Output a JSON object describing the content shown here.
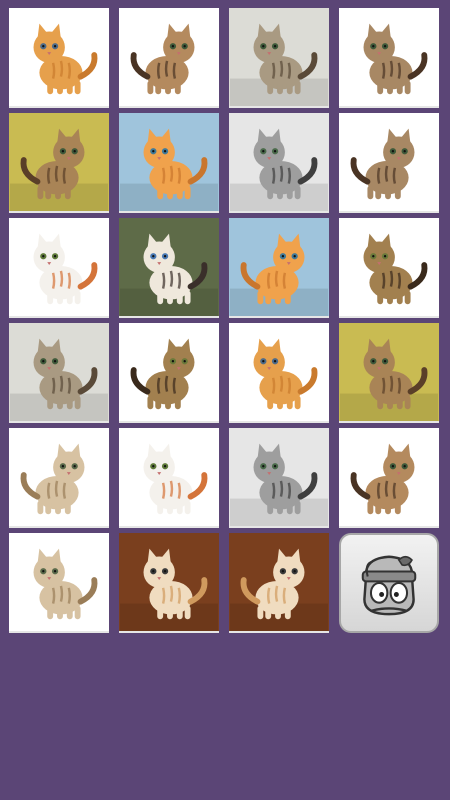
{
  "board": {
    "cards": [
      {
        "icon": "orange-kitten-playing-icon",
        "bg": "#ffffff",
        "fur": "#e6a04c",
        "stripe": "#c97a2d",
        "eyes": "#4d6b8a"
      },
      {
        "icon": "tabby-kitten-sitting-icon",
        "bg": "#ffffff",
        "fur": "#b48a5e",
        "stripe": "#4a3424",
        "eyes": "#3f5a3a"
      },
      {
        "icon": "gray-tabby-walking-icon",
        "bg": "#dcdcd6",
        "fur": "#a99a82",
        "stripe": "#5a4a38",
        "eyes": "#3f5a3a"
      },
      {
        "icon": "tabby-kitten-front-icon",
        "bg": "#ffffff",
        "fur": "#a88864",
        "stripe": "#4a3424",
        "eyes": "#3f5a3a"
      },
      {
        "icon": "tabby-kitten-yellow-bg-icon",
        "bg": "#c9bb52",
        "fur": "#a98456",
        "stripe": "#5a3f28",
        "eyes": "#3f5a3a"
      },
      {
        "icon": "ginger-kitten-blue-bg-icon",
        "bg": "#9fc4dc",
        "fur": "#f0a24c",
        "stripe": "#c9762d",
        "eyes": "#3f7a9a"
      },
      {
        "icon": "silver-tabby-lying-icon",
        "bg": "#e6e6e6",
        "fur": "#9e9e9e",
        "stripe": "#3f3f3f",
        "eyes": "#4a6a4a"
      },
      {
        "icon": "tabby-kitten-front-icon",
        "bg": "#ffffff",
        "fur": "#a88864",
        "stripe": "#4a3424",
        "eyes": "#3f5a3a"
      },
      {
        "icon": "white-cat-red-tail-icon",
        "bg": "#ffffff",
        "fur": "#f4f1ec",
        "stripe": "#d4743a",
        "eyes": "#5f7a3a"
      },
      {
        "icon": "siamese-cat-lying-icon",
        "bg": "#5e6b48",
        "fur": "#efe8dc",
        "stripe": "#3a2f2a",
        "eyes": "#4a7ab4"
      },
      {
        "icon": "ginger-kitten-blue-bg-icon",
        "bg": "#9fc4dc",
        "fur": "#f0a24c",
        "stripe": "#c9762d",
        "eyes": "#3f7a9a"
      },
      {
        "icon": "bengal-cat-standing-icon",
        "bg": "#ffffff",
        "fur": "#a2804f",
        "stripe": "#3a2a1c",
        "eyes": "#6a7a3a"
      },
      {
        "icon": "gray-tabby-walking-icon",
        "bg": "#dcdcd6",
        "fur": "#a99a82",
        "stripe": "#5a4a38",
        "eyes": "#3f5a3a"
      },
      {
        "icon": "bengal-cat-standing-icon",
        "bg": "#ffffff",
        "fur": "#a2804f",
        "stripe": "#3a2a1c",
        "eyes": "#6a7a3a"
      },
      {
        "icon": "orange-kitten-playing-icon",
        "bg": "#ffffff",
        "fur": "#e6a04c",
        "stripe": "#c97a2d",
        "eyes": "#4d6b8a"
      },
      {
        "icon": "tabby-kitten-yellow-bg-icon",
        "bg": "#c9bb52",
        "fur": "#a98456",
        "stripe": "#5a3f28",
        "eyes": "#3f5a3a"
      },
      {
        "icon": "cream-kitten-rolling-icon",
        "bg": "#ffffff",
        "fur": "#d7c2a2",
        "stripe": "#9a7d58",
        "eyes": "#5a6a4a"
      },
      {
        "icon": "white-cat-red-tail-icon",
        "bg": "#ffffff",
        "fur": "#f4f1ec",
        "stripe": "#d4743a",
        "eyes": "#5f7a3a"
      },
      {
        "icon": "silver-tabby-lying-icon",
        "bg": "#e6e6e6",
        "fur": "#9e9e9e",
        "stripe": "#3f3f3f",
        "eyes": "#4a6a4a"
      },
      {
        "icon": "tabby-kitten-sitting-icon",
        "bg": "#ffffff",
        "fur": "#b48a5e",
        "stripe": "#4a3424",
        "eyes": "#3f5a3a"
      },
      {
        "icon": "cream-kitten-rolling-icon",
        "bg": "#ffffff",
        "fur": "#d7c2a2",
        "stripe": "#9a7d58",
        "eyes": "#5a6a4a"
      },
      {
        "icon": "cream-kitten-wood-floor-icon",
        "bg": "#7a3f1e",
        "fur": "#f0dcc0",
        "stripe": "#d09a5e",
        "eyes": "#3a3a3a"
      },
      {
        "icon": "cream-kitten-wood-floor-icon",
        "bg": "#7a3f1e",
        "fur": "#f0dcc0",
        "stripe": "#d09a5e",
        "eyes": "#3a3a3a"
      }
    ],
    "action_button": {
      "icon": "cartoon-cat-mascot-icon"
    }
  },
  "colors": {
    "background": "#5b4576",
    "card": "#ffffff",
    "button_border": "#a7a7a7"
  }
}
